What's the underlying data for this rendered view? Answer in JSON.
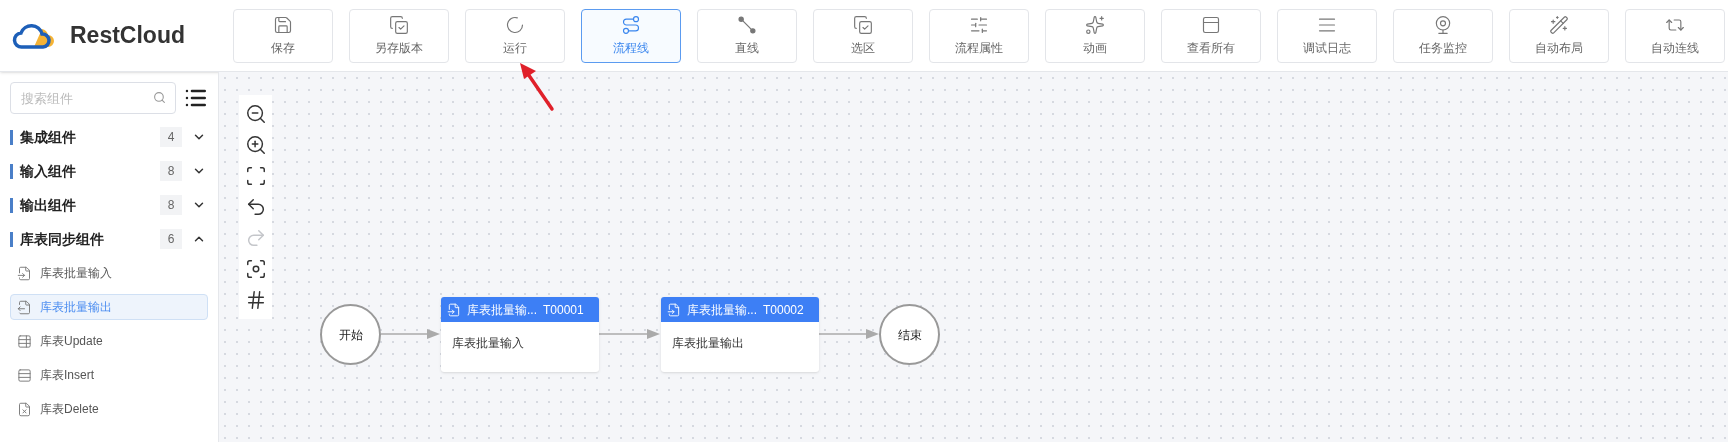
{
  "logo": {
    "text": "RestCloud"
  },
  "toolbar": [
    {
      "label": "保存",
      "selected": false
    },
    {
      "label": "另存版本",
      "selected": false
    },
    {
      "label": "运行",
      "selected": false
    },
    {
      "label": "流程线",
      "selected": true
    },
    {
      "label": "直线",
      "selected": false
    },
    {
      "label": "选区",
      "selected": false
    },
    {
      "label": "流程属性",
      "selected": false
    },
    {
      "label": "动画",
      "selected": false
    },
    {
      "label": "查看所有",
      "selected": false
    },
    {
      "label": "调试日志",
      "selected": false
    },
    {
      "label": "任务监控",
      "selected": false
    },
    {
      "label": "自动布局",
      "selected": false
    },
    {
      "label": "自动连线",
      "selected": false
    }
  ],
  "sidebar": {
    "search": {
      "placeholder": "搜索组件"
    },
    "groups": [
      {
        "label": "集成组件",
        "count": "4",
        "expanded": false
      },
      {
        "label": "输入组件",
        "count": "8",
        "expanded": false
      },
      {
        "label": "输出组件",
        "count": "8",
        "expanded": false
      },
      {
        "label": "库表同步组件",
        "count": "6",
        "expanded": true,
        "children": [
          {
            "label": "库表批量输入",
            "selected": false
          },
          {
            "label": "库表批量输出",
            "selected": true
          },
          {
            "label": "库表Update",
            "selected": false
          },
          {
            "label": "库表Insert",
            "selected": false
          },
          {
            "label": "库表Delete",
            "selected": false
          }
        ]
      }
    ]
  },
  "canvas_tools": [
    {
      "disabled": false
    },
    {
      "disabled": false
    },
    {
      "disabled": false
    },
    {
      "disabled": false
    },
    {
      "disabled": true
    },
    {
      "disabled": false
    },
    {
      "disabled": false
    }
  ],
  "flow": {
    "start": "开始",
    "end": "结束",
    "nodes": [
      {
        "title": "库表批量输...",
        "id": "T00001",
        "body": "库表批量输入"
      },
      {
        "title": "库表批量输...",
        "id": "T00002",
        "body": "库表批量输出"
      }
    ]
  }
}
